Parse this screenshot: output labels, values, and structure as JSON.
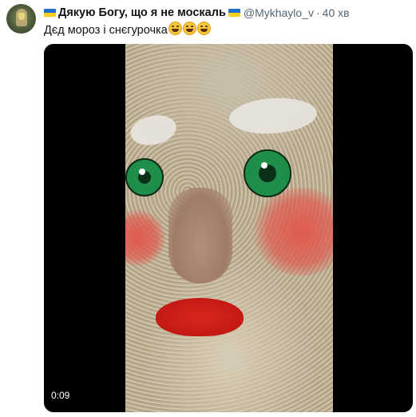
{
  "tweet": {
    "author_name": "Дякую Богу, що я не москаль",
    "handle": "@Mykhaylo_v",
    "separator": "·",
    "time": "40 хв",
    "text": "Дєд мороз і снєгурочка",
    "emoji_names": [
      "face-with-tears-of-joy",
      "face-with-tears-of-joy",
      "face-with-tears-of-joy"
    ],
    "flag_colors": {
      "blue": "#1f6fd1",
      "yellow": "#f5cf1c"
    }
  },
  "video": {
    "timecode": "0:09"
  }
}
